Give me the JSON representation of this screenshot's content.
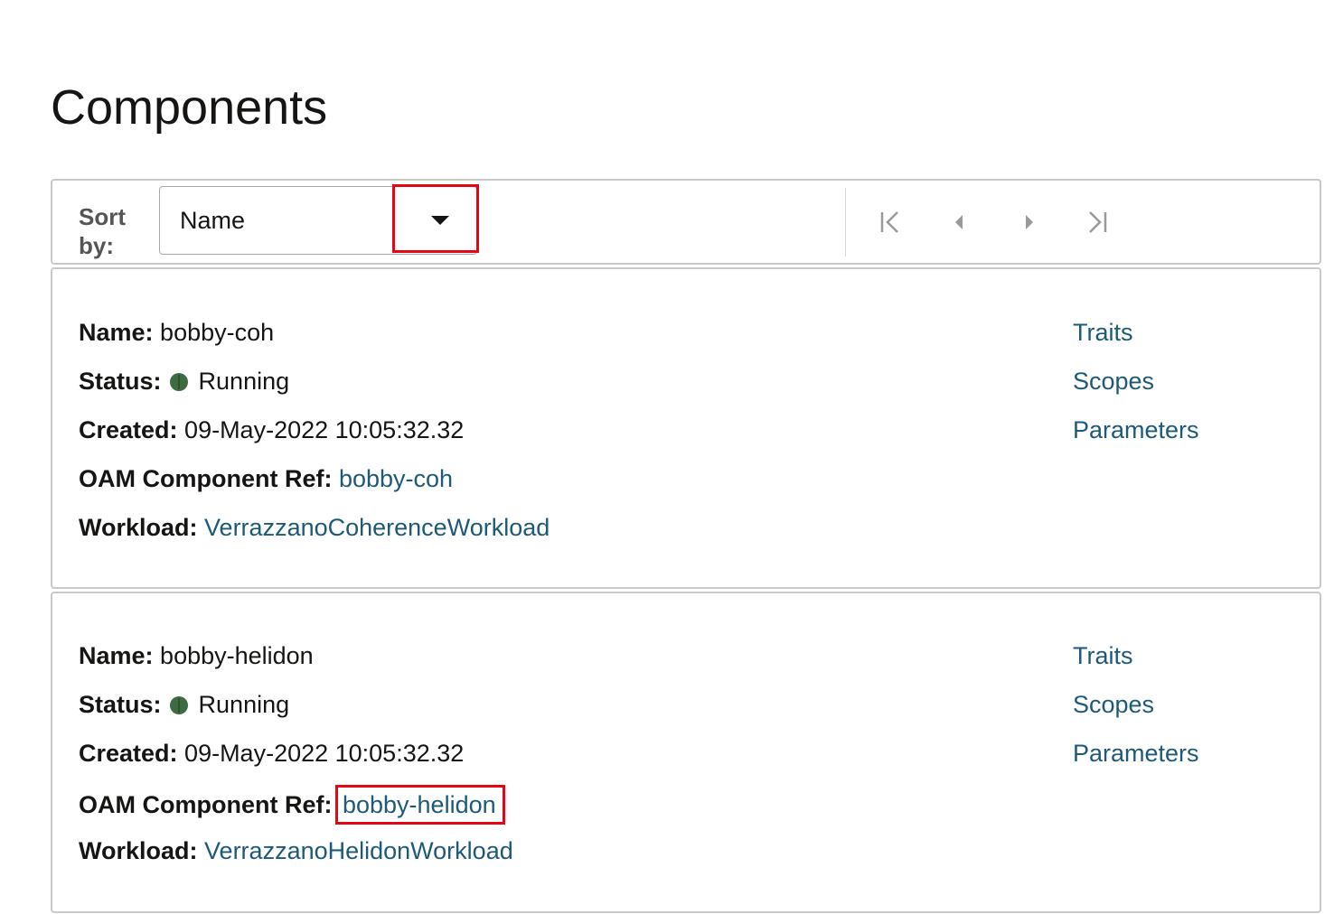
{
  "page": {
    "title": "Components"
  },
  "toolbar": {
    "sort_label": "Sort by:",
    "sort_value": "Name",
    "pager": {
      "first_icon": "first-page-icon",
      "prev_icon": "previous-page-icon",
      "next_icon": "next-page-icon",
      "last_icon": "last-page-icon"
    }
  },
  "components": [
    {
      "name_label": "Name:",
      "name": "bobby-coh",
      "status_label": "Status:",
      "status": "Running",
      "status_color": "#3e6b42",
      "created_label": "Created:",
      "created": "09-May-2022 10:05:32.32",
      "oam_label": "OAM Component Ref:",
      "oam_ref": "bobby-coh",
      "workload_label": "Workload:",
      "workload": "VerrazzanoCoherenceWorkload",
      "links": [
        "Traits",
        "Scopes",
        "Parameters"
      ]
    },
    {
      "name_label": "Name:",
      "name": "bobby-helidon",
      "status_label": "Status:",
      "status": "Running",
      "status_color": "#3e6b42",
      "created_label": "Created:",
      "created": "09-May-2022 10:05:32.32",
      "oam_label": "OAM Component Ref:",
      "oam_ref": "bobby-helidon",
      "workload_label": "Workload:",
      "workload": "VerrazzanoHelidonWorkload",
      "links": [
        "Traits",
        "Scopes",
        "Parameters"
      ]
    }
  ],
  "colors": {
    "link": "#1d5a7a",
    "highlight": "#e30613",
    "border": "#c9c9c9"
  }
}
